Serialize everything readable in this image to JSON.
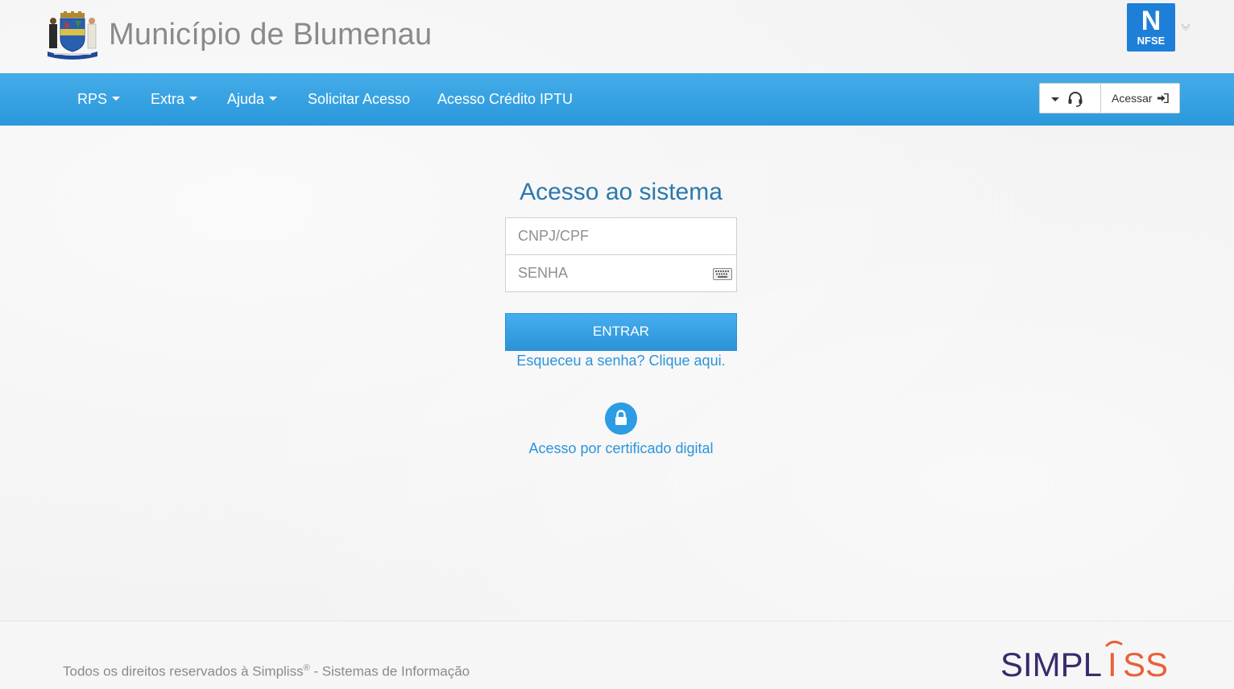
{
  "header": {
    "title": "Município de Blumenau",
    "badge_letter": "N",
    "badge_text": "NFSE"
  },
  "nav": {
    "items": [
      {
        "label": "RPS",
        "dropdown": true
      },
      {
        "label": "Extra",
        "dropdown": true
      },
      {
        "label": "Ajuda",
        "dropdown": true
      },
      {
        "label": "Solicitar Acesso",
        "dropdown": false
      },
      {
        "label": "Acesso Crédito IPTU",
        "dropdown": false
      }
    ],
    "access_label": "Acessar"
  },
  "login": {
    "title": "Acesso ao sistema",
    "cnpj_placeholder": "CNPJ/CPF",
    "senha_placeholder": "SENHA",
    "enter_label": "ENTRAR",
    "forgot_label": "Esqueceu a senha? Clique aqui.",
    "cert_label": "Acesso por certificado digital"
  },
  "footer": {
    "copyright_prefix": "Todos os direitos reservados à Simpliss",
    "copyright_mark": "®",
    "copyright_suffix": " - Sistemas de Informação",
    "logo_text_start": "SIMPL",
    "logo_text_i": "I",
    "logo_text_end": "SS"
  },
  "colors": {
    "nav_blue": "#2a98dc",
    "title_blue": "#2b78ad",
    "link_blue": "#2c94da",
    "badge_blue": "#1e7fd8",
    "logo_purple": "#3b2a6b",
    "logo_orange": "#e8603a"
  }
}
